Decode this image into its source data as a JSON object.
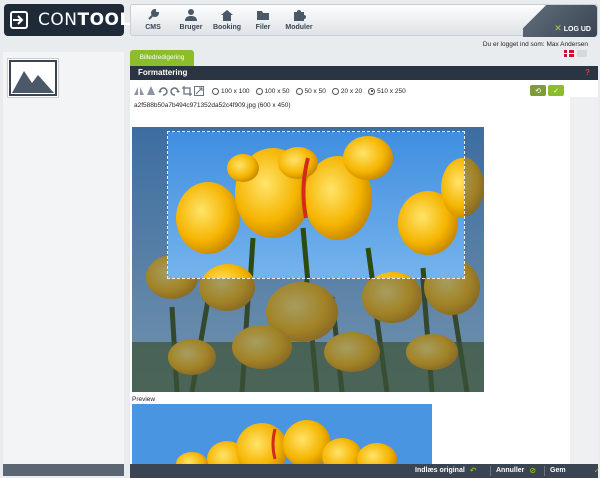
{
  "header": {
    "logo_text_light": "CON",
    "logo_text_bold": "TOOL",
    "nav": [
      {
        "label": "CMS",
        "icon": "wrench-icon"
      },
      {
        "label": "Bruger",
        "icon": "user-icon"
      },
      {
        "label": "Booking",
        "icon": "house-icon"
      },
      {
        "label": "Filer",
        "icon": "folder-icon"
      },
      {
        "label": "Moduler",
        "icon": "puzzle-icon"
      }
    ],
    "logout_label": "LOG UD",
    "user_prefix": "Du er logget ind som:",
    "user_name": "Max Andersen"
  },
  "tab_label": "Billedredigering",
  "panel_title": "Formattering",
  "help_symbol": "?",
  "size_options": [
    {
      "label": "100 x 100",
      "selected": false
    },
    {
      "label": "100 x 50",
      "selected": false
    },
    {
      "label": "50 x 50",
      "selected": false
    },
    {
      "label": "20 x 20",
      "selected": false
    },
    {
      "label": "510 x 250",
      "selected": true
    }
  ],
  "file_name": "a2f588b50a7b494c971352da52c4f909.jpg (600 x 450)",
  "preview_label": "Preview",
  "bottom": {
    "reload_label": "Indlæs original",
    "cancel_label": "Annuller",
    "save_label": "Gem"
  },
  "colors": {
    "accent": "#8cbd2a",
    "dark": "#2a3442",
    "bar": "#3a4452"
  }
}
